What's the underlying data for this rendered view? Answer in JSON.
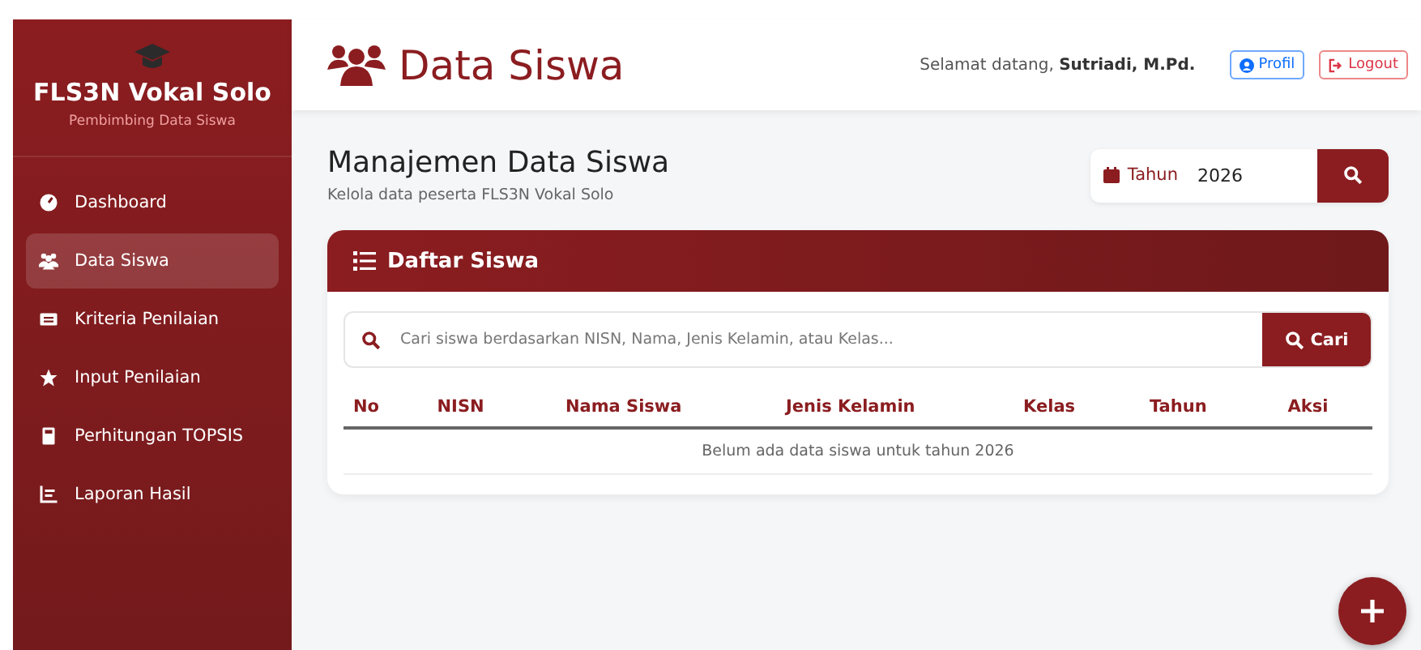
{
  "sidebar": {
    "title": "FLS3N Vokal Solo",
    "subtitle": "Pembimbing Data Siswa",
    "items": [
      {
        "label": "Dashboard",
        "selected": false
      },
      {
        "label": "Data Siswa",
        "selected": true
      },
      {
        "label": "Kriteria Penilaian",
        "selected": false
      },
      {
        "label": "Input Penilaian",
        "selected": false
      },
      {
        "label": "Perhitungan TOPSIS",
        "selected": false
      },
      {
        "label": "Laporan Hasil",
        "selected": false
      }
    ]
  },
  "header": {
    "title": "Data Siswa",
    "greeting": "Selamat datang, **Sutriadi, M.Pd.**",
    "buttons": [
      "Profil",
      "Logout"
    ]
  },
  "page": {
    "title": "Manajemen Data Siswa",
    "subtitle": "Kelola data peserta FLS3N Vokal Solo",
    "year_label": "Tahun",
    "year_value": "2026"
  },
  "card": {
    "title": "Daftar Siswa",
    "search": {
      "placeholder": "Cari siswa berdasarkan NISN, Nama, Jenis Kelamin, atau Kelas...",
      "button": "Cari"
    },
    "table": {
      "columns": [
        "No",
        "NISN",
        "Nama Siswa",
        "Jenis Kelamin",
        "Kelas",
        "Tahun",
        "Aksi"
      ],
      "empty_message": "Belum ada data siswa untuk tahun 2026"
    }
  }
}
